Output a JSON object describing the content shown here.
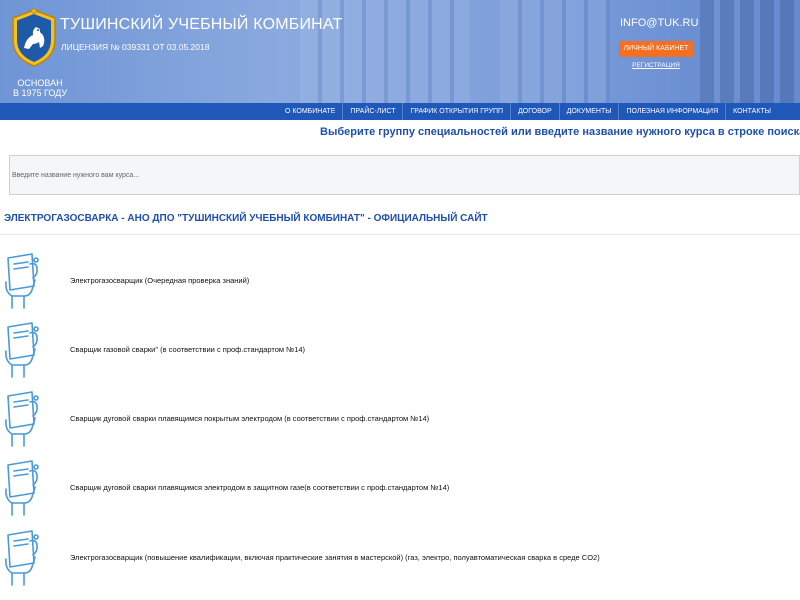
{
  "header": {
    "org_name": "ТУШИНСКИЙ УЧЕБНЫЙ КОМБИНАТ",
    "license": "ЛИЦЕНЗИЯ № 039331 ОТ 03.05.2018",
    "since_line1": "ОСНОВАН",
    "since_line2": "В 1975 ГОДУ",
    "email": "INFO@TUK.RU",
    "cabinet_label": "ЛИЧНЫЙ КАБИНЕТ",
    "register_label": "РЕГИСТРАЦИЯ"
  },
  "nav": {
    "items": [
      "О КОМБИНАТЕ",
      "ПРАЙС-ЛИСТ",
      "ГРАФИК ОТКРЫТИЯ ГРУПП",
      "ДОГОВОР",
      "ДОКУМЕНТЫ",
      "ПОЛЕЗНАЯ ИНФОРМАЦИЯ",
      "КОНТАКТЫ"
    ]
  },
  "search": {
    "prompt": "Выберите группу специальностей или введите название нужного курса в строке поиска.",
    "placeholder": "Введите название нужного вам курса..."
  },
  "page": {
    "title": "ЭЛЕКТРОГАЗОСВАРКА - АНО ДПО \"ТУШИНСКИЙ УЧЕБНЫЙ КОМБИНАТ\" - ОФИЦИАЛЬНЫЙ САЙТ"
  },
  "courses": [
    "Электрогазосварщик (Очередная проверка знаний)",
    "Сварщик газовой сварки\" (в соответствии с проф.стандартом №14)",
    "Сварщик дуговой сварки плавящимся покрытым электродом (в соответствии с проф.стандартом №14)",
    "Сварщик дуговой сварки плавящимся электродом в защитном газе(в соответствии с проф.стандартом №14)",
    "Электрогазосварщик (повышение квалификации, включая практические занятия в мастерской) (газ, электро, полуавтоматическая сварка в среде CO2)"
  ],
  "colors": {
    "header_blue": "#7e9fdb",
    "nav_blue": "#1f58b8",
    "accent_blue": "#1f4fad",
    "orange_button": "#f36f21",
    "icon_blue": "#4a9ad8"
  },
  "icons": {
    "logo": "horse-emblem-icon",
    "course": "certificate-hand-icon"
  }
}
